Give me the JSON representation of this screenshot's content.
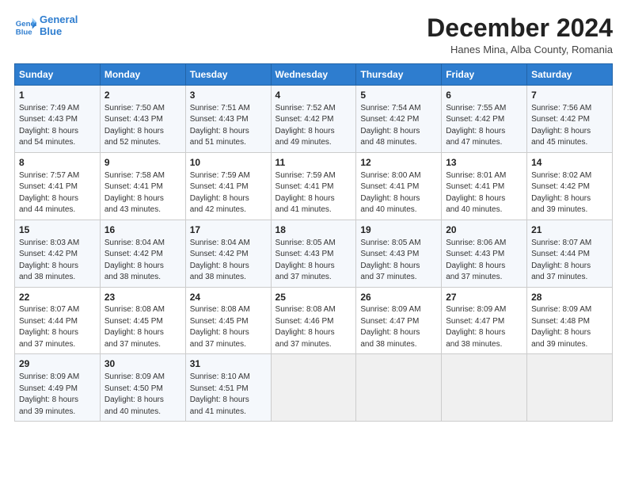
{
  "header": {
    "logo_line1": "General",
    "logo_line2": "Blue",
    "title": "December 2024",
    "location": "Hanes Mina, Alba County, Romania"
  },
  "weekdays": [
    "Sunday",
    "Monday",
    "Tuesday",
    "Wednesday",
    "Thursday",
    "Friday",
    "Saturday"
  ],
  "weeks": [
    [
      {
        "day": "1",
        "text": "Sunrise: 7:49 AM\nSunset: 4:43 PM\nDaylight: 8 hours\nand 54 minutes."
      },
      {
        "day": "2",
        "text": "Sunrise: 7:50 AM\nSunset: 4:43 PM\nDaylight: 8 hours\nand 52 minutes."
      },
      {
        "day": "3",
        "text": "Sunrise: 7:51 AM\nSunset: 4:43 PM\nDaylight: 8 hours\nand 51 minutes."
      },
      {
        "day": "4",
        "text": "Sunrise: 7:52 AM\nSunset: 4:42 PM\nDaylight: 8 hours\nand 49 minutes."
      },
      {
        "day": "5",
        "text": "Sunrise: 7:54 AM\nSunset: 4:42 PM\nDaylight: 8 hours\nand 48 minutes."
      },
      {
        "day": "6",
        "text": "Sunrise: 7:55 AM\nSunset: 4:42 PM\nDaylight: 8 hours\nand 47 minutes."
      },
      {
        "day": "7",
        "text": "Sunrise: 7:56 AM\nSunset: 4:42 PM\nDaylight: 8 hours\nand 45 minutes."
      }
    ],
    [
      {
        "day": "8",
        "text": "Sunrise: 7:57 AM\nSunset: 4:41 PM\nDaylight: 8 hours\nand 44 minutes."
      },
      {
        "day": "9",
        "text": "Sunrise: 7:58 AM\nSunset: 4:41 PM\nDaylight: 8 hours\nand 43 minutes."
      },
      {
        "day": "10",
        "text": "Sunrise: 7:59 AM\nSunset: 4:41 PM\nDaylight: 8 hours\nand 42 minutes."
      },
      {
        "day": "11",
        "text": "Sunrise: 7:59 AM\nSunset: 4:41 PM\nDaylight: 8 hours\nand 41 minutes."
      },
      {
        "day": "12",
        "text": "Sunrise: 8:00 AM\nSunset: 4:41 PM\nDaylight: 8 hours\nand 40 minutes."
      },
      {
        "day": "13",
        "text": "Sunrise: 8:01 AM\nSunset: 4:41 PM\nDaylight: 8 hours\nand 40 minutes."
      },
      {
        "day": "14",
        "text": "Sunrise: 8:02 AM\nSunset: 4:42 PM\nDaylight: 8 hours\nand 39 minutes."
      }
    ],
    [
      {
        "day": "15",
        "text": "Sunrise: 8:03 AM\nSunset: 4:42 PM\nDaylight: 8 hours\nand 38 minutes."
      },
      {
        "day": "16",
        "text": "Sunrise: 8:04 AM\nSunset: 4:42 PM\nDaylight: 8 hours\nand 38 minutes."
      },
      {
        "day": "17",
        "text": "Sunrise: 8:04 AM\nSunset: 4:42 PM\nDaylight: 8 hours\nand 38 minutes."
      },
      {
        "day": "18",
        "text": "Sunrise: 8:05 AM\nSunset: 4:43 PM\nDaylight: 8 hours\nand 37 minutes."
      },
      {
        "day": "19",
        "text": "Sunrise: 8:05 AM\nSunset: 4:43 PM\nDaylight: 8 hours\nand 37 minutes."
      },
      {
        "day": "20",
        "text": "Sunrise: 8:06 AM\nSunset: 4:43 PM\nDaylight: 8 hours\nand 37 minutes."
      },
      {
        "day": "21",
        "text": "Sunrise: 8:07 AM\nSunset: 4:44 PM\nDaylight: 8 hours\nand 37 minutes."
      }
    ],
    [
      {
        "day": "22",
        "text": "Sunrise: 8:07 AM\nSunset: 4:44 PM\nDaylight: 8 hours\nand 37 minutes."
      },
      {
        "day": "23",
        "text": "Sunrise: 8:08 AM\nSunset: 4:45 PM\nDaylight: 8 hours\nand 37 minutes."
      },
      {
        "day": "24",
        "text": "Sunrise: 8:08 AM\nSunset: 4:45 PM\nDaylight: 8 hours\nand 37 minutes."
      },
      {
        "day": "25",
        "text": "Sunrise: 8:08 AM\nSunset: 4:46 PM\nDaylight: 8 hours\nand 37 minutes."
      },
      {
        "day": "26",
        "text": "Sunrise: 8:09 AM\nSunset: 4:47 PM\nDaylight: 8 hours\nand 38 minutes."
      },
      {
        "day": "27",
        "text": "Sunrise: 8:09 AM\nSunset: 4:47 PM\nDaylight: 8 hours\nand 38 minutes."
      },
      {
        "day": "28",
        "text": "Sunrise: 8:09 AM\nSunset: 4:48 PM\nDaylight: 8 hours\nand 39 minutes."
      }
    ],
    [
      {
        "day": "29",
        "text": "Sunrise: 8:09 AM\nSunset: 4:49 PM\nDaylight: 8 hours\nand 39 minutes."
      },
      {
        "day": "30",
        "text": "Sunrise: 8:09 AM\nSunset: 4:50 PM\nDaylight: 8 hours\nand 40 minutes."
      },
      {
        "day": "31",
        "text": "Sunrise: 8:10 AM\nSunset: 4:51 PM\nDaylight: 8 hours\nand 41 minutes."
      },
      {
        "day": "",
        "text": ""
      },
      {
        "day": "",
        "text": ""
      },
      {
        "day": "",
        "text": ""
      },
      {
        "day": "",
        "text": ""
      }
    ]
  ]
}
